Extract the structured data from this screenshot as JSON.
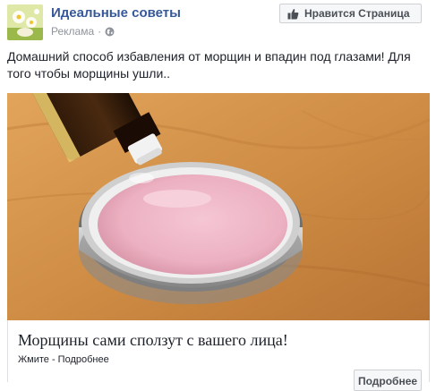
{
  "header": {
    "page_name": "Идеальные советы",
    "sponsored_label": "Реклама",
    "separator": "·",
    "like_button_label": "Нравится Страница"
  },
  "post": {
    "text": "Домашний способ избавления от морщин и впадин под глазами! Для того чтобы морщины ушли.."
  },
  "link_preview": {
    "headline": "Морщины сами сползут с вашего лица!",
    "subline": "Жмите - Подробнее",
    "cta_label": "Подробнее"
  },
  "icons": {
    "avatar": "page-avatar-flowers",
    "globe": "globe-icon",
    "like": "thumbs-up-icon"
  },
  "colors": {
    "link_blue": "#365899",
    "meta_gray": "#90949c",
    "button_bg": "#f6f7f9",
    "button_border": "#ced0d4"
  }
}
